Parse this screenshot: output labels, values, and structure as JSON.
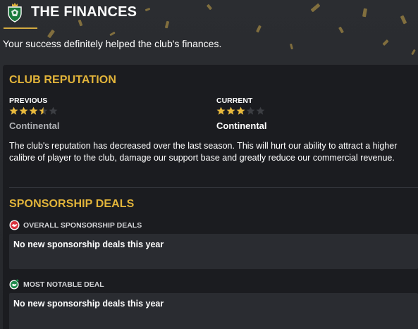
{
  "header": {
    "title": "THE FINANCES",
    "subtitle": "Your success definitely helped the club's finances.",
    "crest_icon": "club-crest-icon"
  },
  "colors": {
    "accent": "#d2aa41",
    "section_title": "#e2b43a",
    "star_filled": "#e8b93c",
    "star_empty": "#3c3e43",
    "panel_bg": "#1b1c20",
    "box_bg": "#2a2c31"
  },
  "club_reputation": {
    "title": "CLUB REPUTATION",
    "previous": {
      "label": "PREVIOUS",
      "stars": 3.5,
      "max_stars": 5,
      "value": "Continental"
    },
    "current": {
      "label": "CURRENT",
      "stars": 3,
      "max_stars": 5,
      "value": "Continental"
    },
    "description": "The club's reputation has decreased over the last season. This will hurt our ability to attract a higher calibre of player to the club, damage our support base and greatly reduce our commercial revenue."
  },
  "sponsorship_deals": {
    "title": "SPONSORSHIP DEALS",
    "overall": {
      "label": "OVERALL SPONSORSHIP DEALS",
      "icon": "handshake-icon",
      "text": "No new sponsorship deals this year"
    },
    "notable": {
      "label": "MOST NOTABLE DEAL",
      "icon": "handshake-plus-icon",
      "text": "No new sponsorship deals this year"
    }
  }
}
